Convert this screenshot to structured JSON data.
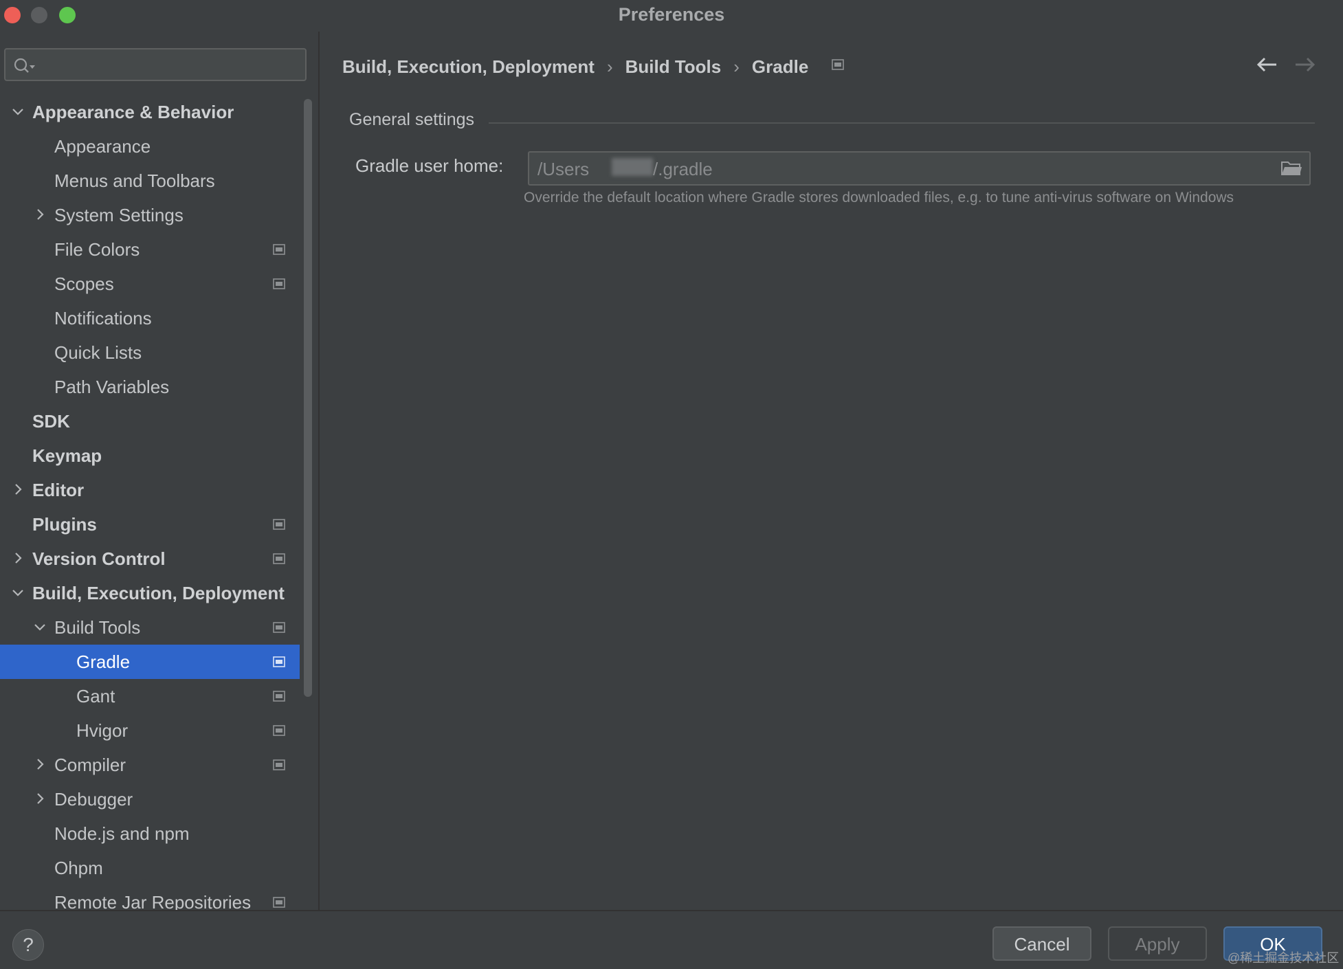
{
  "window": {
    "title": "Preferences"
  },
  "search": {
    "placeholder": ""
  },
  "tree": {
    "items": [
      {
        "label": "Appearance & Behavior",
        "bold": true,
        "level": 0,
        "expander": "expanded",
        "project": false,
        "selected": false
      },
      {
        "label": "Appearance",
        "bold": false,
        "level": 1,
        "expander": "none",
        "project": false,
        "selected": false
      },
      {
        "label": "Menus and Toolbars",
        "bold": false,
        "level": 1,
        "expander": "none",
        "project": false,
        "selected": false
      },
      {
        "label": "System Settings",
        "bold": false,
        "level": 1,
        "expander": "collapsed",
        "project": false,
        "selected": false
      },
      {
        "label": "File Colors",
        "bold": false,
        "level": 1,
        "expander": "none",
        "project": true,
        "selected": false
      },
      {
        "label": "Scopes",
        "bold": false,
        "level": 1,
        "expander": "none",
        "project": true,
        "selected": false
      },
      {
        "label": "Notifications",
        "bold": false,
        "level": 1,
        "expander": "none",
        "project": false,
        "selected": false
      },
      {
        "label": "Quick Lists",
        "bold": false,
        "level": 1,
        "expander": "none",
        "project": false,
        "selected": false
      },
      {
        "label": "Path Variables",
        "bold": false,
        "level": 1,
        "expander": "none",
        "project": false,
        "selected": false
      },
      {
        "label": "SDK",
        "bold": true,
        "level": 0,
        "expander": "none",
        "project": false,
        "selected": false
      },
      {
        "label": "Keymap",
        "bold": true,
        "level": 0,
        "expander": "none",
        "project": false,
        "selected": false
      },
      {
        "label": "Editor",
        "bold": true,
        "level": 0,
        "expander": "collapsed",
        "project": false,
        "selected": false
      },
      {
        "label": "Plugins",
        "bold": true,
        "level": 0,
        "expander": "none",
        "project": true,
        "selected": false
      },
      {
        "label": "Version Control",
        "bold": true,
        "level": 0,
        "expander": "collapsed",
        "project": true,
        "selected": false
      },
      {
        "label": "Build, Execution, Deployment",
        "bold": true,
        "level": 0,
        "expander": "expanded",
        "project": false,
        "selected": false
      },
      {
        "label": "Build Tools",
        "bold": false,
        "level": 1,
        "expander": "expanded",
        "project": true,
        "selected": false
      },
      {
        "label": "Gradle",
        "bold": false,
        "level": 2,
        "expander": "none",
        "project": true,
        "selected": true
      },
      {
        "label": "Gant",
        "bold": false,
        "level": 2,
        "expander": "none",
        "project": true,
        "selected": false
      },
      {
        "label": "Hvigor",
        "bold": false,
        "level": 2,
        "expander": "none",
        "project": true,
        "selected": false
      },
      {
        "label": "Compiler",
        "bold": false,
        "level": 1,
        "expander": "collapsed",
        "project": true,
        "selected": false
      },
      {
        "label": "Debugger",
        "bold": false,
        "level": 1,
        "expander": "collapsed",
        "project": false,
        "selected": false
      },
      {
        "label": "Node.js and npm",
        "bold": false,
        "level": 1,
        "expander": "none",
        "project": false,
        "selected": false
      },
      {
        "label": "Ohpm",
        "bold": false,
        "level": 1,
        "expander": "none",
        "project": false,
        "selected": false
      },
      {
        "label": "Remote Jar Repositories",
        "bold": false,
        "level": 1,
        "expander": "none",
        "project": true,
        "selected": false
      }
    ]
  },
  "breadcrumb": {
    "part1": "Build, Execution, Deployment",
    "part2": "Build Tools",
    "part3": "Gradle",
    "separator": "›"
  },
  "settings": {
    "section_title": "General settings",
    "gradle_home_label": "Gradle user home:",
    "gradle_home_value_prefix": "/Users",
    "gradle_home_value_suffix": "/.gradle",
    "gradle_home_hint": "Override the default location where Gradle stores downloaded files, e.g. to tune anti-virus software on Windows"
  },
  "buttons": {
    "help": "?",
    "cancel": "Cancel",
    "apply": "Apply",
    "ok": "OK"
  },
  "watermark": "@稀土掘金技术社区",
  "colors": {
    "selection": "#2f65ca",
    "background": "#3c3f41",
    "ok_button": "#365880"
  }
}
